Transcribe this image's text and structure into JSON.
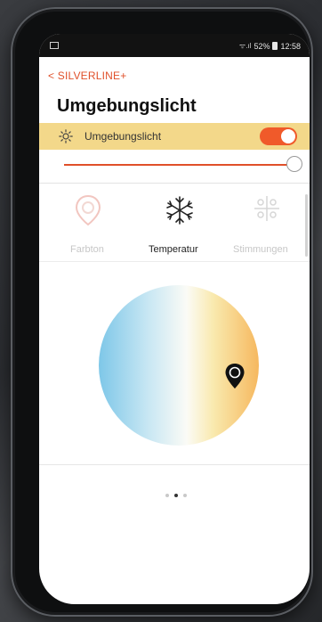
{
  "status_bar": {
    "signal_text": "ᯤ.ıl",
    "battery": "52%",
    "time": "12:58"
  },
  "nav": {
    "back_label": "< SILVERLINE+"
  },
  "page": {
    "title": "Umgebungslicht"
  },
  "light_control": {
    "label": "Umgebungslicht",
    "toggle_on": true,
    "brightness_percent": 100
  },
  "tabs": [
    {
      "label": "Farbton",
      "active": false
    },
    {
      "label": "Temperatur",
      "active": true
    },
    {
      "label": "Stimmungen",
      "active": false
    }
  ],
  "pager": {
    "count": 3,
    "active_index": 1
  },
  "colors": {
    "accent": "#e0502a",
    "toggle": "#f05a2a",
    "highlight_row": "#f3d88a"
  }
}
